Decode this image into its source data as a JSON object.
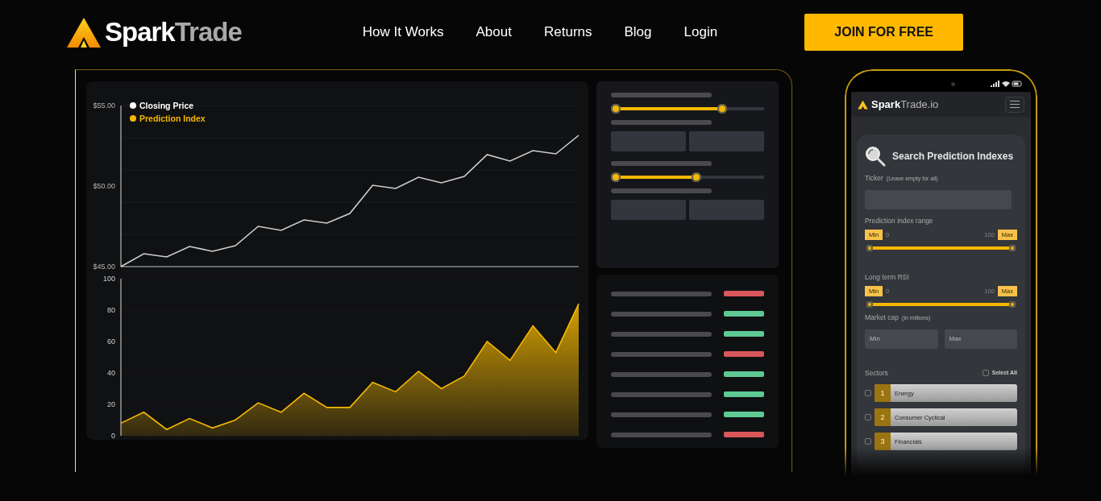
{
  "brand": {
    "first": "Spark",
    "second": "Trade"
  },
  "nav": [
    {
      "label": "How It Works"
    },
    {
      "label": "About"
    },
    {
      "label": "Returns"
    },
    {
      "label": "Blog"
    },
    {
      "label": "Login"
    }
  ],
  "cta": "JOIN FOR FREE",
  "dashboard": {
    "price_chart": {
      "chart_data": {
        "type": "line",
        "series": [
          {
            "name": "Closing Price",
            "color": "#ffffff",
            "values": [
              45.0,
              45.8,
              45.6,
              46.25,
              45.95,
              46.3,
              47.5,
              47.25,
              47.9,
              47.7,
              48.3,
              50.05,
              49.85,
              50.55,
              50.2,
              50.6,
              51.95,
              51.55,
              52.2,
              52.0,
              53.15
            ]
          }
        ],
        "ylim": [
          45,
          55
        ],
        "yticks": [
          {
            "value": 45,
            "label": "$45.00"
          },
          {
            "value": 50,
            "label": "$50.00"
          },
          {
            "value": 55,
            "label": "$55.00"
          }
        ]
      }
    },
    "index_chart": {
      "chart_data": {
        "type": "area",
        "series": [
          {
            "name": "Prediction Index",
            "color": "#f5b800",
            "values": [
              8,
              15,
              4,
              11,
              5,
              10,
              21,
              15,
              27,
              18,
              18,
              34,
              28,
              41,
              30,
              38,
              60,
              48,
              70,
              53,
              84
            ]
          }
        ],
        "ylim": [
          0,
          100
        ],
        "yticks": [
          0,
          20,
          40,
          60,
          80,
          100
        ]
      }
    },
    "filters": [
      {
        "kind": "label"
      },
      {
        "kind": "range",
        "level": 0.74
      },
      {
        "kind": "label"
      },
      {
        "kind": "inputs"
      },
      {
        "kind": "label"
      },
      {
        "kind": "range",
        "level": 0.56
      },
      {
        "kind": "label"
      },
      {
        "kind": "inputs"
      }
    ],
    "results": [
      {
        "color": "#d9575b"
      },
      {
        "color": "#5ec994"
      },
      {
        "color": "#5ec994"
      },
      {
        "color": "#d9575b"
      },
      {
        "color": "#5ec994"
      },
      {
        "color": "#5ec994"
      },
      {
        "color": "#5ec994"
      },
      {
        "color": "#d9575b"
      }
    ]
  },
  "phone": {
    "brand": {
      "first": "Spark",
      "second": "Trade.io"
    },
    "title": "Search Prediction Indexes",
    "ticker": {
      "label": "Ticker",
      "hint": "(Leave empty for all)"
    },
    "ranges": [
      {
        "label": "Prediction index range",
        "min_label": "Min",
        "min_value": "0",
        "max_value": "100",
        "max_label": "Max",
        "level": 1
      },
      {
        "label": "Long term RSI",
        "min_label": "Min",
        "min_value": "0",
        "max_value": "100",
        "max_label": "Max",
        "level": 1
      }
    ],
    "market_cap": {
      "label": "Market cap",
      "hint": "(in millions)",
      "min_placeholder": "Min",
      "max_placeholder": "Max"
    },
    "sectors": {
      "label": "Sectors",
      "select_all": {
        "label": "Select All",
        "checked": false
      },
      "items": [
        {
          "number": "1",
          "name": "Energy",
          "checked": false
        },
        {
          "number": "2",
          "name": "Consumer Cyclical",
          "checked": false
        },
        {
          "number": "3",
          "name": "Financials",
          "checked": false
        }
      ]
    }
  }
}
